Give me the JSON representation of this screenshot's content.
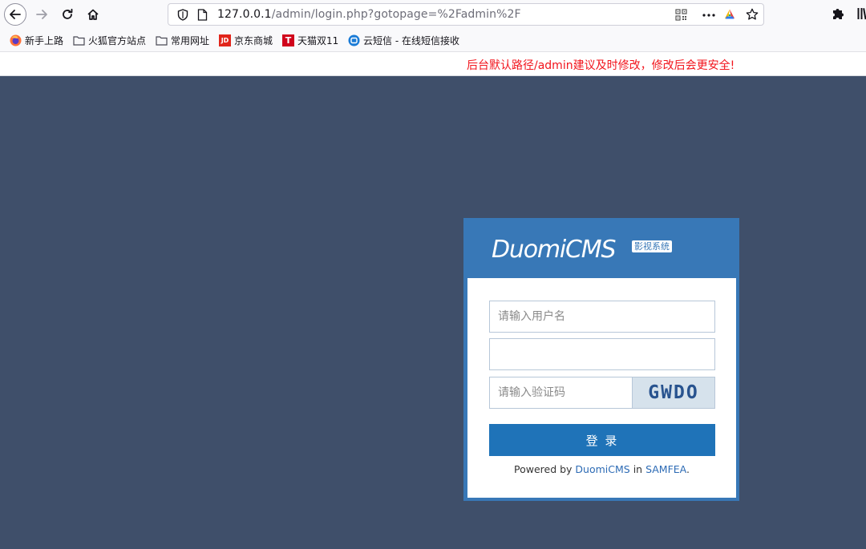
{
  "browser": {
    "url": {
      "host": "127.0.0.1",
      "path": "/admin/login.php?gotopage=%2Fadmin%2F"
    },
    "icons": {
      "back": "back-arrow-icon",
      "forward": "forward-arrow-icon",
      "reload": "reload-icon",
      "home": "home-icon",
      "shield": "tracking-shield-icon",
      "page": "page-icon",
      "qr": "qr-code-icon",
      "more": "more-dots-icon",
      "addon": "colorful-addon-icon",
      "star": "bookmark-star-icon",
      "extensions": "puzzle-piece-icon",
      "library": "library-icon"
    },
    "bookmarks": [
      {
        "label": "新手上路",
        "icon": "firefox-icon"
      },
      {
        "label": "火狐官方站点",
        "icon": "folder-icon"
      },
      {
        "label": "常用网址",
        "icon": "folder-icon"
      },
      {
        "label": "京东商城",
        "icon": "jd-icon",
        "icon_text": "JD"
      },
      {
        "label": "天猫双11",
        "icon": "tmall-icon",
        "icon_text": "T"
      },
      {
        "label": "云短信 - 在线短信接收",
        "icon": "cloud-sms-icon"
      }
    ]
  },
  "notice": {
    "text": "后台默认路径/admin建议及时修改，修改后会更安全!",
    "color": "#f2141c"
  },
  "login": {
    "logo": "DuomiCMS",
    "logo_tag": "影视系统",
    "username_placeholder": "请输入用户名",
    "password_placeholder": "",
    "captcha_placeholder": "请输入验证码",
    "captcha_code": "GWDO",
    "submit_label": "登 录",
    "powered_prefix": "Powered by",
    "powered_brand": "DuomiCMS",
    "powered_in": "in",
    "powered_org": "SAMFEA",
    "powered_suffix": "."
  },
  "colors": {
    "page_background": "#3f4f6a",
    "login_frame": "#3878b7",
    "login_button": "#1f73b8",
    "link": "#2d6bb5"
  }
}
